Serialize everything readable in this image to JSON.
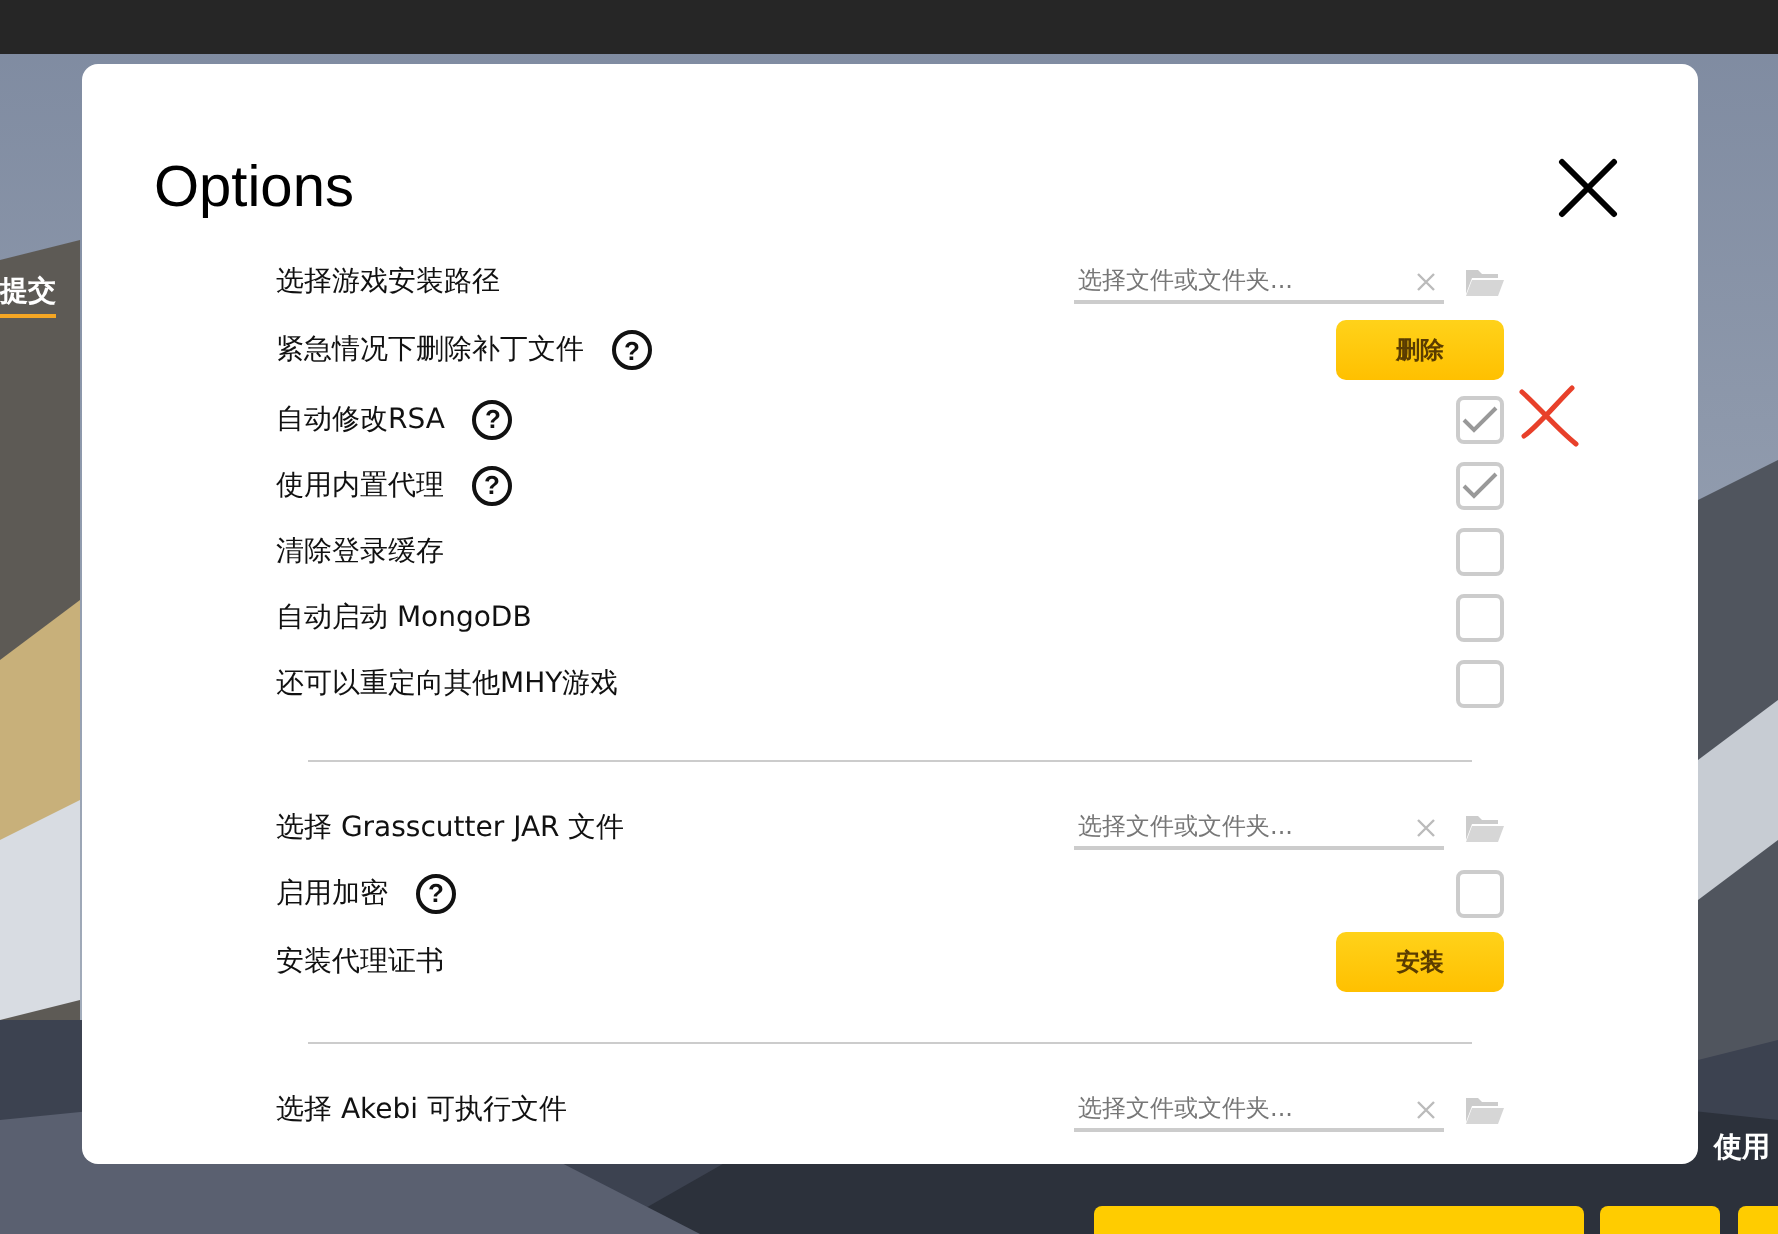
{
  "background": {
    "kind": "picture",
    "side_tab": {
      "label": "提交",
      "selected": true
    },
    "side_label": "使用"
  },
  "dialog": {
    "title": "Options",
    "sections": [
      {
        "rows": [
          {
            "kind": "file",
            "label": "选择游戏安装路径",
            "placeholder": "选择文件或文件夹..."
          },
          {
            "kind": "button",
            "label": "紧急情况下删除补丁文件",
            "help": "?",
            "button": "删除"
          },
          {
            "kind": "checkbox",
            "label": "自动修改RSA",
            "help": "?",
            "checked": true
          },
          {
            "kind": "checkbox",
            "label": "使用内置代理",
            "help": "?",
            "checked": true
          },
          {
            "kind": "checkbox",
            "label": "清除登录缓存",
            "checked": false
          },
          {
            "kind": "checkbox",
            "label": "自动启动 MongoDB",
            "checked": false
          },
          {
            "kind": "checkbox",
            "label": "还可以重定向其他MHY游戏",
            "checked": false
          }
        ]
      },
      {
        "rows": [
          {
            "kind": "file",
            "label": "选择 Grasscutter JAR 文件",
            "placeholder": "选择文件或文件夹..."
          },
          {
            "kind": "checkbox",
            "label": "启用加密",
            "help": "?",
            "checked": false
          },
          {
            "kind": "button",
            "label": "安装代理证书",
            "button": "安装"
          }
        ]
      },
      {
        "rows": [
          {
            "kind": "file",
            "label": "选择 Akebi 可执行文件",
            "placeholder": "选择文件或文件夹..."
          }
        ]
      }
    ]
  }
}
